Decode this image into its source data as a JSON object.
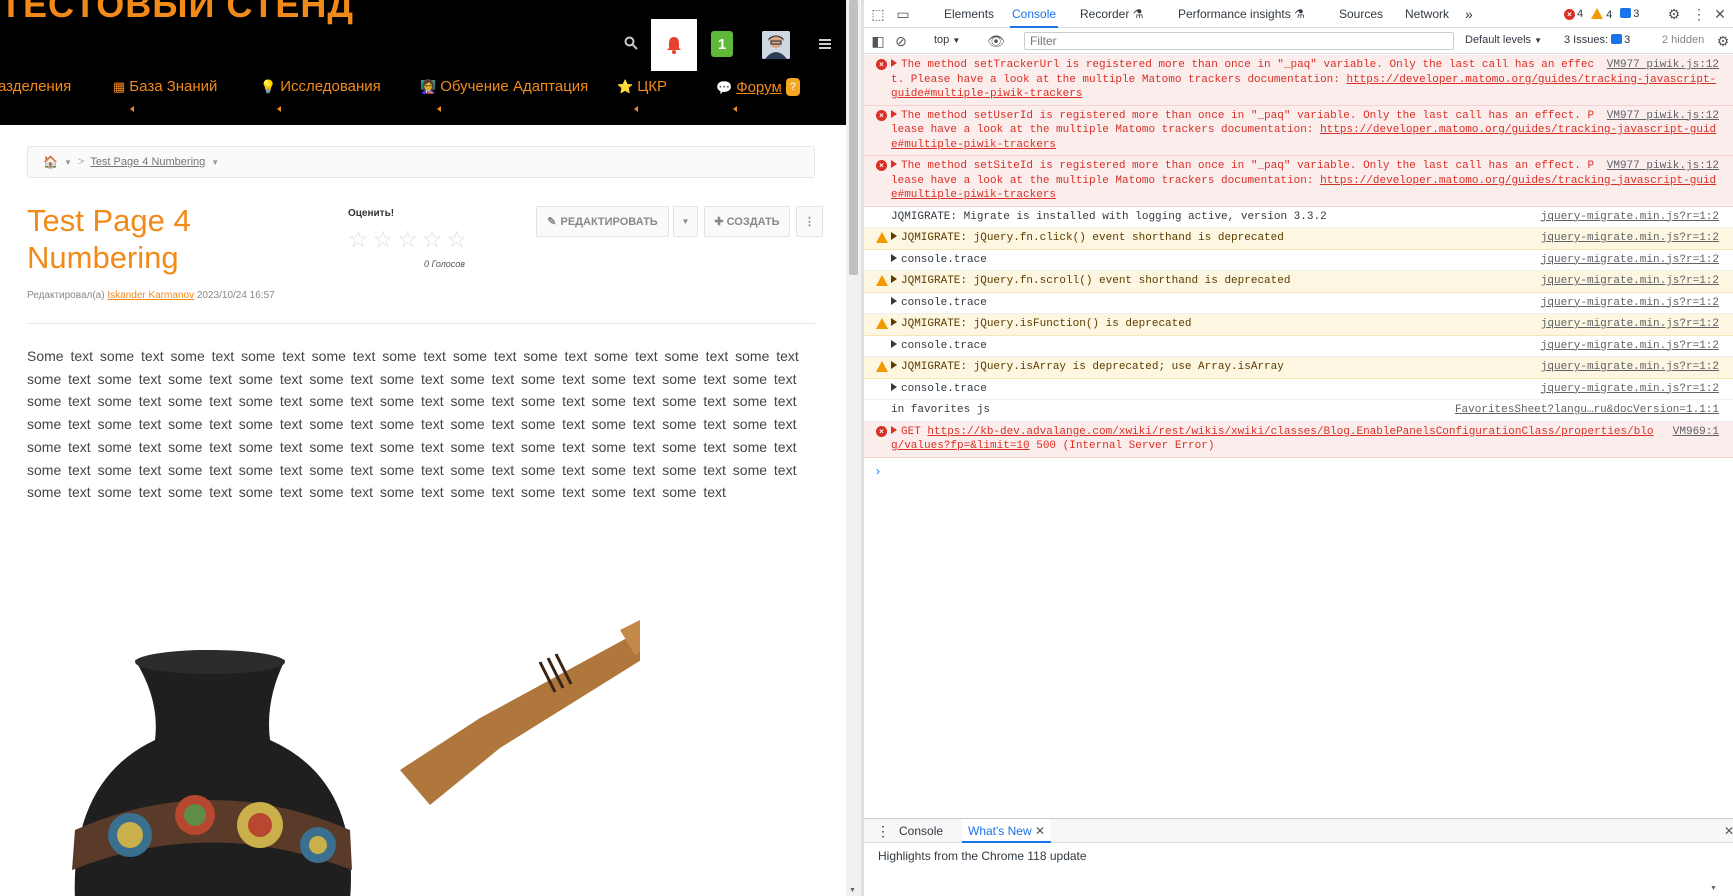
{
  "site": {
    "title": "ТЕСТОВЫЙ СТЕНД",
    "notification_badge": "1",
    "nav": [
      {
        "label": "азделения",
        "icon": ""
      },
      {
        "label": "База Знаний",
        "icon": "table-icon"
      },
      {
        "label": "Исследования",
        "icon": "lightbulb-icon"
      },
      {
        "label": "Обучение Адаптация",
        "icon": "teacher-icon"
      },
      {
        "label": "ЦКР",
        "icon": "star-icon"
      },
      {
        "label": "Форум",
        "icon": "chat-icon",
        "badge": "?"
      }
    ]
  },
  "breadcrumb": {
    "current": "Test Page 4 Numbering"
  },
  "page": {
    "title": "Test Page 4 Numbering",
    "rating_label": "Оценить!",
    "rating_value": 0,
    "votes": "0 Голосов",
    "edit_label": "РЕДАКТИРОВАТЬ",
    "create_label": "СОЗДАТЬ",
    "meta_prefix": "Редактировал(а)",
    "meta_author": "Iskander Karmanov",
    "meta_date": "2023/10/24 16:57",
    "body_text": "Some text some text  some text  some text  some text  some text  some text  some text  some text  some text  some text  some text  some text  some text  some text  some text  some text  some text  some text  some text  some text  some text  some text  some text  some text  some text  some text  some text  some text  some text  some text  some text  some text  some text  some text  some text  some text  some text  some text  some text  some text  some text  some text  some text  some text  some text  some text  some text  some text  some text  some text  some text  some text  some text  some text  some text  some text  some text  some text  some text  some text  some text  some text  some text  some text  some text  some text  some text  some text  some text  some text  some text  some text  some text  some text  some text"
  },
  "devtools": {
    "tabs": [
      "Elements",
      "Console",
      "Recorder",
      "Performance insights",
      "Sources",
      "Network"
    ],
    "active_tab": "Console",
    "errors": "4",
    "warnings": "4",
    "info": "3",
    "context": "top",
    "filter_placeholder": "Filter",
    "levels": "Default levels",
    "issues_label": "3 Issues:",
    "issues_count": "3",
    "hidden": "2 hidden",
    "messages": [
      {
        "level": "error",
        "expand": true,
        "text": "The method setTrackerUrl is registered more than once in \"_paq\" variable. Only the last call has an effect. Please have a look at the multiple Matomo trackers documentation: ",
        "link": "https://developer.matomo.org/guides/tracking-javascript-guide#multiple-piwik-trackers",
        "src": "VM977 piwik.js:12"
      },
      {
        "level": "error",
        "expand": true,
        "text": "The method setUserId is registered more than once in \"_paq\" variable. Only the last call has an effect. Please have a look at the multiple Matomo trackers documentation: ",
        "link": "https://developer.matomo.org/guides/tracking-javascript-guide#multiple-piwik-trackers",
        "src": "VM977 piwik.js:12"
      },
      {
        "level": "error",
        "expand": true,
        "text": "The method setSiteId is registered more than once in \"_paq\" variable. Only the last call has an effect. Please have a look at the multiple Matomo trackers documentation: ",
        "link": "https://developer.matomo.org/guides/tracking-javascript-guide#multiple-piwik-trackers",
        "src": "VM977 piwik.js:12"
      },
      {
        "level": "log",
        "expand": false,
        "text": "JQMIGRATE: Migrate is installed with logging active, version 3.3.2",
        "link": "",
        "src": "jquery-migrate.min.js?r=1:2"
      },
      {
        "level": "warn",
        "expand": true,
        "text": "JQMIGRATE: jQuery.fn.click() event shorthand is deprecated",
        "link": "",
        "src": "jquery-migrate.min.js?r=1:2"
      },
      {
        "level": "log",
        "expand": true,
        "text": "console.trace",
        "link": "",
        "src": "jquery-migrate.min.js?r=1:2"
      },
      {
        "level": "warn",
        "expand": true,
        "text": "JQMIGRATE: jQuery.fn.scroll() event shorthand is deprecated",
        "link": "",
        "src": "jquery-migrate.min.js?r=1:2"
      },
      {
        "level": "log",
        "expand": true,
        "text": "console.trace",
        "link": "",
        "src": "jquery-migrate.min.js?r=1:2"
      },
      {
        "level": "warn",
        "expand": true,
        "text": "JQMIGRATE: jQuery.isFunction() is deprecated",
        "link": "",
        "src": "jquery-migrate.min.js?r=1:2"
      },
      {
        "level": "log",
        "expand": true,
        "text": "console.trace",
        "link": "",
        "src": "jquery-migrate.min.js?r=1:2"
      },
      {
        "level": "warn",
        "expand": true,
        "text": "JQMIGRATE: jQuery.isArray is deprecated; use Array.isArray",
        "link": "",
        "src": "jquery-migrate.min.js?r=1:2"
      },
      {
        "level": "log",
        "expand": true,
        "text": "console.trace",
        "link": "",
        "src": "jquery-migrate.min.js?r=1:2"
      },
      {
        "level": "log",
        "expand": false,
        "text": "in favorites js",
        "link": "",
        "src": "FavoritesSheet?langu…ru&docVersion=1.1:1"
      },
      {
        "level": "error",
        "expand": true,
        "text": "GET ",
        "link": "https://kb-dev.advalange.com/xwiki/rest/wikis/xwiki/classes/Blog.EnablePanelsConfigurationClass/properties/blog/values?fp=&limit=10",
        "suffix": " 500 (Internal Server Error)",
        "src": "VM969:1"
      }
    ],
    "drawer_tabs": [
      "Console",
      "What's New"
    ],
    "drawer_text": "Highlights from the Chrome 118 update"
  }
}
